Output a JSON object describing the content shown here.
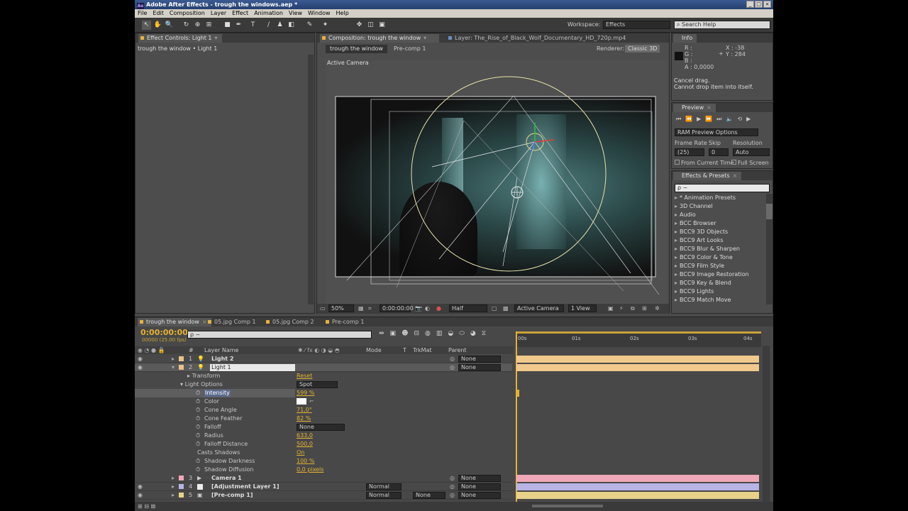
{
  "window": {
    "title": "Adobe After Effects - trough the windows.aep *",
    "logo": "Ae"
  },
  "menu": [
    "File",
    "Edit",
    "Composition",
    "Layer",
    "Effect",
    "Animation",
    "View",
    "Window",
    "Help"
  ],
  "toolbar": {
    "workspace_label": "Workspace:",
    "workspace_value": "Effects",
    "search_placeholder": "Search Help"
  },
  "effect_controls": {
    "tab": "Effect Controls: Light 1",
    "breadcrumb": "trough the window • Light 1"
  },
  "composition": {
    "tab": "Composition: trough the window",
    "layer_tab": "Layer: The_Rise_of_Black_Wolf_Documentary_HD_720p.mp4",
    "crumbs": [
      "trough the window",
      "Pre-comp 1"
    ],
    "renderer_label": "Renderer:",
    "renderer_value": "Classic 3D",
    "view_label": "Active Camera",
    "zoom": "50%",
    "timecode": "0:00:00:00",
    "resolution": "Half",
    "camera": "Active Camera",
    "views": "1 View"
  },
  "info": {
    "tab": "Info",
    "rgba": [
      "R :",
      "G :",
      "B :",
      "A : 0,0000"
    ],
    "x": "X : -38",
    "y": "Y : 284",
    "msg1": "Cancel drag.",
    "msg2": "Cannot drop item into itself."
  },
  "preview": {
    "tab": "Preview",
    "ram_options": "RAM Preview Options",
    "frame_rate_label": "Frame Rate",
    "skip_label": "Skip",
    "resolution_label": "Resolution",
    "frame_rate": "(25)",
    "skip": "0",
    "resolution": "Auto",
    "from_current": "From Current Time",
    "full_screen": "Full Screen"
  },
  "effects_presets": {
    "tab": "Effects & Presets",
    "search": "ρ ~",
    "items": [
      "* Animation Presets",
      "3D Channel",
      "Audio",
      "BCC Browser",
      "BCC9 3D Objects",
      "BCC9 Art Looks",
      "BCC9 Blur & Sharpen",
      "BCC9 Color & Tone",
      "BCC9 Film Style",
      "BCC9 Image Restoration",
      "BCC9 Key & Blend",
      "BCC9 Lights",
      "BCC9 Match Move"
    ]
  },
  "timeline": {
    "tabs": [
      "trough the window",
      "05.jpg Comp 1",
      "05.jpg Comp 2",
      "Pre-comp 1"
    ],
    "timecode": "0:00:00:00",
    "frame_info": "00000 (25.00 fps)",
    "search": "ρ ~",
    "columns": {
      "num": "#",
      "layer_name": "Layer Name",
      "mode": "Mode",
      "t": "T",
      "trkmat": "TrkMat",
      "parent": "Parent"
    },
    "ruler": [
      "00s",
      "01s",
      "02s",
      "03s",
      "04s"
    ],
    "layers": [
      {
        "num": "1",
        "name": "Light 2",
        "parent": "None"
      },
      {
        "num": "2",
        "name": "Light 1",
        "parent": "None"
      },
      {
        "num": "3",
        "name": "Camera 1",
        "parent": "None"
      },
      {
        "num": "4",
        "name": "[Adjustment Layer 1]",
        "mode": "Normal",
        "parent": "None"
      },
      {
        "num": "5",
        "name": "[Pre-comp 1]",
        "mode": "Normal",
        "trkmat": "None",
        "parent": "None"
      }
    ],
    "props": {
      "transform": "Transform",
      "reset": "Reset",
      "light_options": "Light Options",
      "light_type": "Spot",
      "intensity": "Intensity",
      "intensity_val": "599 %",
      "color": "Color",
      "cone_angle": "Cone Angle",
      "cone_angle_val": "71,0°",
      "cone_feather": "Cone Feather",
      "cone_feather_val": "82 %",
      "falloff": "Falloff",
      "falloff_val": "None",
      "radius": "Radius",
      "radius_val": "633,0",
      "falloff_distance": "Falloff Distance",
      "falloff_distance_val": "500,0",
      "casts_shadows": "Casts Shadows",
      "casts_shadows_val": "On",
      "shadow_darkness": "Shadow Darkness",
      "shadow_darkness_val": "100 %",
      "shadow_diffusion": "Shadow Diffusion",
      "shadow_diffusion_val": "0,0 pixels"
    }
  },
  "colors": {
    "accent_gold": "#e3b231",
    "track_light": "#f0c98c",
    "track_camera": "#f0a8b8",
    "track_adjust": "#b8b4e6",
    "track_precomp": "#e8d28a"
  }
}
